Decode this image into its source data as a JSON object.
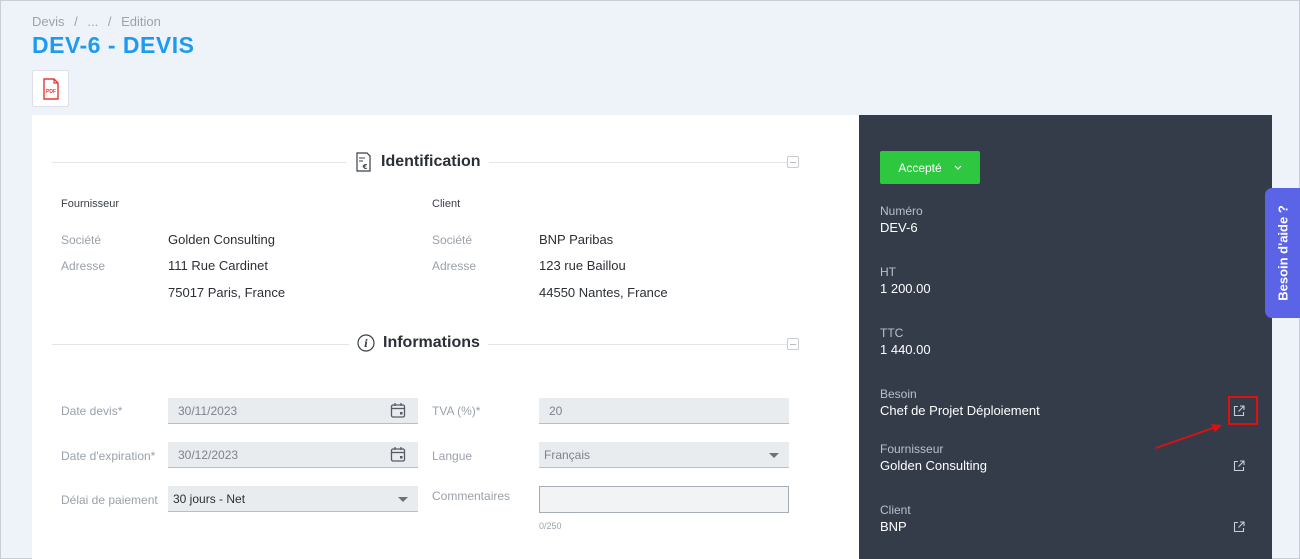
{
  "breadcrumb": [
    "Devis",
    "/",
    "...",
    "/",
    "Edition"
  ],
  "page_title": "DEV-6 - DEVIS",
  "pdf_label": "PDF",
  "identification": {
    "title": "Identification",
    "fournisseur": {
      "heading": "Fournisseur",
      "societe_label": "Société",
      "societe": "Golden Consulting",
      "adresse_label": "Adresse",
      "adresse_line1": "111 Rue Cardinet",
      "adresse_line2": "75017 Paris, France"
    },
    "client": {
      "heading": "Client",
      "societe_label": "Société",
      "societe": "BNP Paribas",
      "adresse_label": "Adresse",
      "adresse_line1": "123 rue Baillou",
      "adresse_line2": "44550 Nantes, France"
    }
  },
  "informations": {
    "title": "Informations",
    "date_devis_label": "Date devis*",
    "date_devis": "30/11/2023",
    "date_expiration_label": "Date d'expiration*",
    "date_expiration": "30/12/2023",
    "delai_label": "Délai de paiement",
    "delai": "30 jours - Net",
    "tva_label": "TVA (%)*",
    "tva": "20",
    "langue_label": "Langue",
    "langue": "Français",
    "commentaires_label": "Commentaires",
    "commentaires_counter": "0/250"
  },
  "side": {
    "status": "Accepté",
    "numero_label": "Numéro",
    "numero": "DEV-6",
    "ht_label": "HT",
    "ht": "1 200.00",
    "ttc_label": "TTC",
    "ttc": "1 440.00",
    "besoin_label": "Besoin",
    "besoin": "Chef de Projet Déploiement",
    "fournisseur_label": "Fournisseur",
    "fournisseur": "Golden Consulting",
    "client_label": "Client",
    "client": "BNP"
  },
  "help_tab": "Besoin d'aide ?",
  "colors": {
    "title_blue": "#1d9bf0",
    "accent_green": "#2ec840",
    "side_panel": "#343c4a",
    "help_purple": "#5b63e6",
    "highlight_red": "#e01010"
  }
}
